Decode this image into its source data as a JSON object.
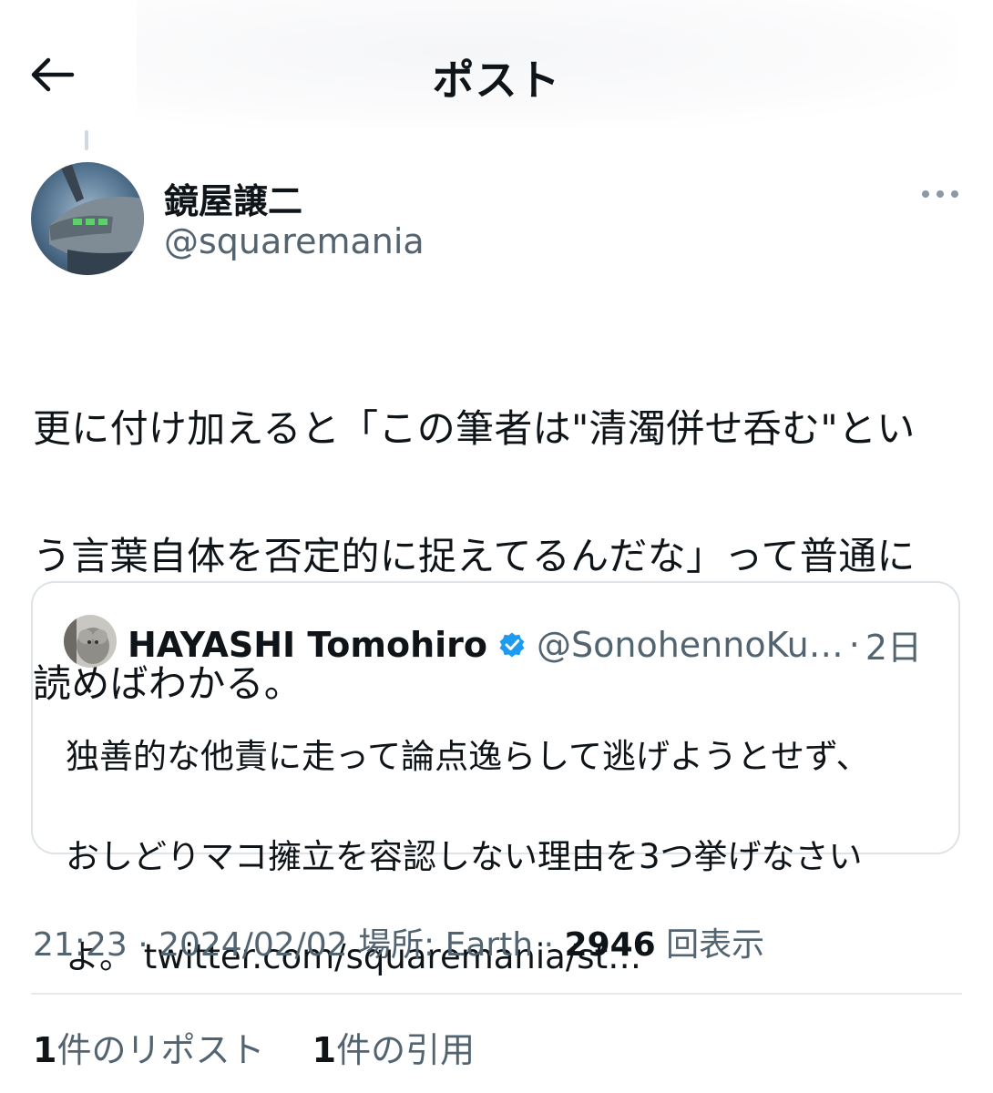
{
  "header": {
    "title": "ポスト"
  },
  "post": {
    "author_name": "鏡屋譲二",
    "author_handle": "@squaremania",
    "text": "更に付け加えると「この筆者は\"清濁併せ呑む\"という言葉自体を否定的に捉えてるんだな」って普通に読めばわかる。",
    "text_lines": [
      "更に付け加えると「この筆者は\"清濁併せ呑む\"とい",
      "う言葉自体を否定的に捉えてるんだな」って普通に",
      "読めばわかる。"
    ]
  },
  "quote": {
    "author_name": "HAYASHI Tomohiro",
    "author_handle": "@SonohennoKu…",
    "separator": "·",
    "time": "2日",
    "text_lines": [
      "独善的な他責に走って論点逸らして逃げようとせず、",
      "おしどりマコ擁立を容認しない理由を3つ挙げなさい",
      "よ。 twitter.com/squaremania/st…"
    ]
  },
  "meta": {
    "time": "21:23",
    "date": "2024/02/02",
    "location": "場所: Earth",
    "views_count": "2946",
    "views_label": "回表示"
  },
  "stats": {
    "reposts_count": "1",
    "reposts_label": "件のリポスト",
    "quotes_count": "1",
    "quotes_label": "件の引用"
  },
  "colors": {
    "text_primary": "#0f1419",
    "text_secondary": "#536471",
    "border": "#dde3e7",
    "verified": "#1d9bf0"
  },
  "icons": {
    "back": "arrow-left-icon",
    "more": "more-horizontal-icon",
    "verified": "verified-badge-icon"
  }
}
